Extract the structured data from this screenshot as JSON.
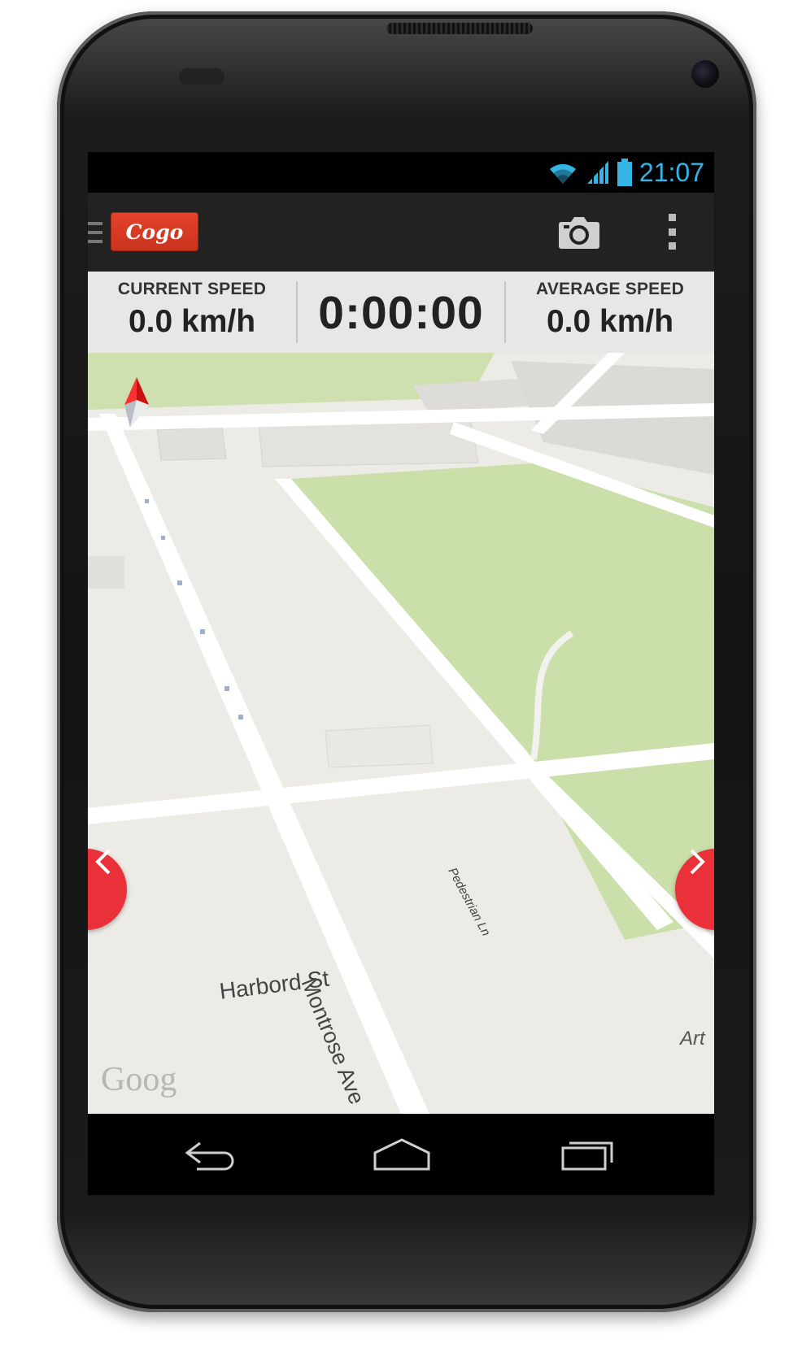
{
  "status_bar": {
    "time": "21:07",
    "icons": [
      "wifi-icon",
      "signal-icon",
      "battery-icon"
    ]
  },
  "action_bar": {
    "logo_text": "Cogo",
    "icons": [
      "menu-drawer-icon",
      "camera-icon",
      "overflow-menu-icon"
    ]
  },
  "stats": {
    "current_speed_label": "CURRENT SPEED",
    "current_speed_value": "0.0 km/h",
    "timer_value": "0:00:00",
    "average_speed_label": "AVERAGE SPEED",
    "average_speed_value": "0.0 km/h"
  },
  "map": {
    "street_labels": [
      "Harbord St",
      "Montrose Ave",
      "Pedestrian Ln"
    ],
    "place_label": "Art",
    "attribution": "Goog"
  },
  "colors": {
    "accent_red": "#ea3139",
    "status_blue": "#33b5e5",
    "park_green": "#cbdfaa",
    "map_land": "#ecebe6",
    "road": "#ffffff"
  }
}
